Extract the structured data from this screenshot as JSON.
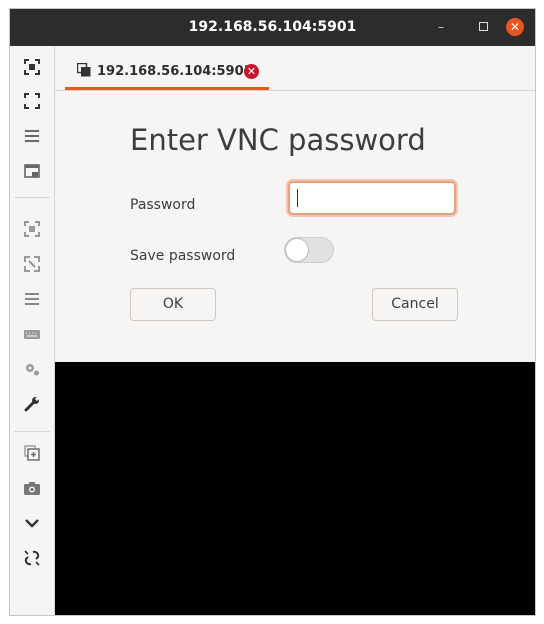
{
  "window": {
    "title": "192.168.56.104:5901"
  },
  "tab": {
    "label": "192.168.56.104:5901",
    "close_glyph": "✕"
  },
  "toolbar": {
    "icons": [
      "fit-window-icon",
      "fullscreen-icon",
      "menu-icon",
      "scaled-window-icon",
      "dynamic-resolution-icon",
      "scale-icon",
      "menu-icon",
      "keyboard-icon",
      "preferences-icon",
      "tools-icon",
      "duplicate-icon",
      "screenshot-icon",
      "chevron-down-icon",
      "disconnect-icon"
    ]
  },
  "dialog": {
    "heading": "Enter VNC password",
    "password_label": "Password",
    "password_value": "",
    "save_label": "Save password",
    "save_enabled": false,
    "ok_label": "OK",
    "cancel_label": "Cancel"
  },
  "colors": {
    "accent": "#e95420",
    "titlebar": "#2c2c2c",
    "close_badge": "#c7162b"
  }
}
